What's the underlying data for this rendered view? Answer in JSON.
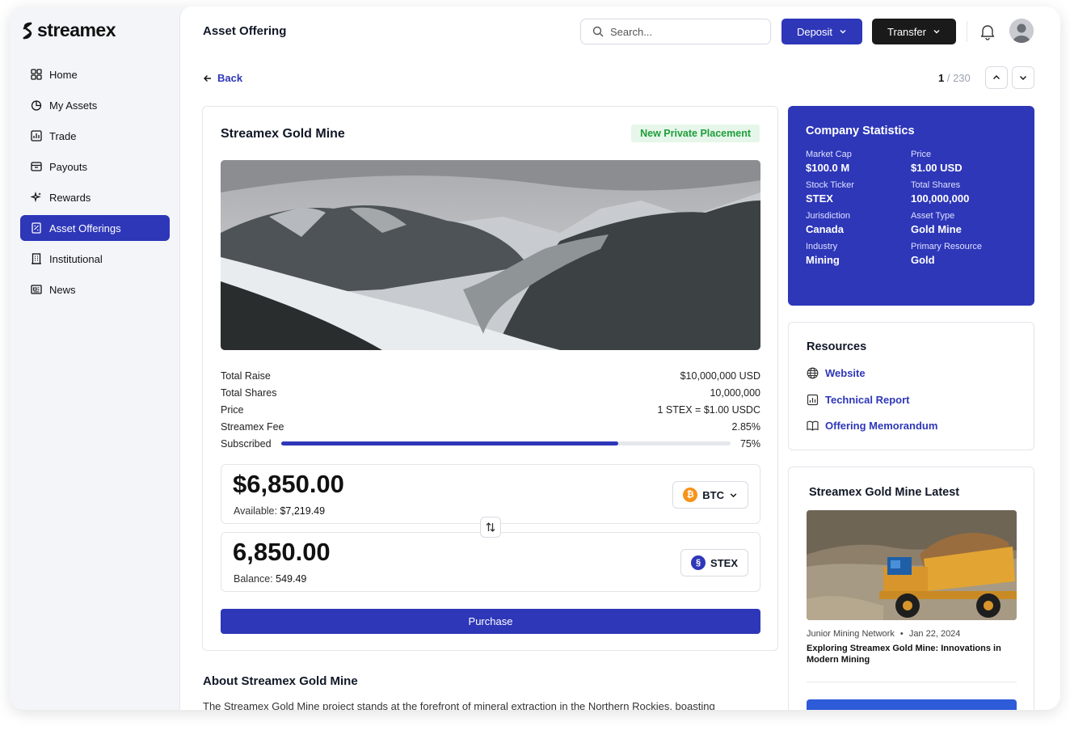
{
  "brand": {
    "name": "streamex"
  },
  "sidebar": {
    "items": [
      {
        "label": "Home",
        "icon": "grid-icon"
      },
      {
        "label": "My Assets",
        "icon": "pie-chart-icon"
      },
      {
        "label": "Trade",
        "icon": "bar-chart-icon"
      },
      {
        "label": "Payouts",
        "icon": "archive-icon"
      },
      {
        "label": "Rewards",
        "icon": "sparkle-icon"
      },
      {
        "label": "Asset Offerings",
        "icon": "document-icon",
        "active": true
      },
      {
        "label": "Institutional",
        "icon": "building-icon"
      },
      {
        "label": "News",
        "icon": "newspaper-icon"
      }
    ]
  },
  "header": {
    "title": "Asset Offering",
    "search_placeholder": "Search...",
    "deposit_label": "Deposit",
    "transfer_label": "Transfer"
  },
  "nav": {
    "back_label": "Back",
    "page_current": "1",
    "page_sep": " / ",
    "page_total": "230"
  },
  "offering": {
    "title": "Streamex Gold Mine",
    "badge": "New Private Placement",
    "rows": [
      {
        "label": "Total Raise",
        "value": "$10,000,000 USD"
      },
      {
        "label": "Total Shares",
        "value": "10,000,000"
      },
      {
        "label": "Price",
        "value": "1 STEX = $1.00 USDC"
      },
      {
        "label": "Streamex Fee",
        "value": "2.85%"
      }
    ],
    "subscribed_label": "Subscribed",
    "subscribed_value": "75%",
    "subscribed_fraction": 0.75,
    "pay": {
      "amount": "$6,850.00",
      "available_label": "Available:",
      "available_value": "$7,219.49",
      "currency": "BTC"
    },
    "receive": {
      "amount": "6,850.00",
      "balance_label": "Balance:",
      "balance_value": "549.49",
      "currency": "STEX"
    },
    "purchase_label": "Purchase"
  },
  "about": {
    "title": "About Streamex Gold Mine",
    "text": "The Streamex Gold Mine project stands at the forefront of mineral extraction in the Northern Rockies, boasting"
  },
  "company": {
    "title": "Company Statistics",
    "stats": [
      {
        "label": "Market Cap",
        "value": "$100.0 M"
      },
      {
        "label": "Price",
        "value": "$1.00 USD"
      },
      {
        "label": "Stock Ticker",
        "value": "STEX"
      },
      {
        "label": "Total Shares",
        "value": "100,000,000"
      },
      {
        "label": "Jurisdiction",
        "value": "Canada"
      },
      {
        "label": "Asset Type",
        "value": "Gold Mine"
      },
      {
        "label": "Industry",
        "value": "Mining"
      },
      {
        "label": "Primary Resource",
        "value": "Gold"
      }
    ]
  },
  "resources": {
    "title": "Resources",
    "links": [
      {
        "label": "Website",
        "icon": "globe-icon"
      },
      {
        "label": "Technical Report",
        "icon": "report-icon"
      },
      {
        "label": "Offering Memorandum",
        "icon": "book-icon"
      }
    ]
  },
  "latest": {
    "title": "Streamex Gold Mine Latest",
    "source": "Junior Mining Network",
    "dot": "•",
    "date": "Jan 22, 2024",
    "headline": "Exploring Streamex Gold Mine: Innovations in Modern Mining"
  },
  "colors": {
    "accent": "#2e37b8",
    "badge_bg": "#e6f6ea",
    "badge_text": "#1f9d3a",
    "btc": "#f7931a"
  }
}
